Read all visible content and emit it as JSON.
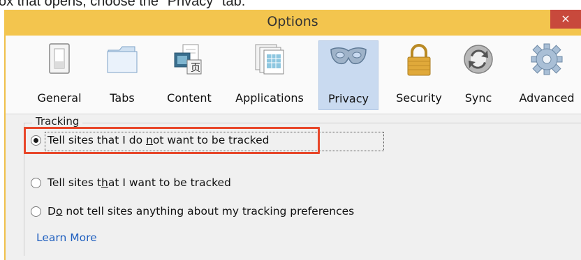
{
  "caption": "ox that opens, choose the \"Privacy\" tab.",
  "window": {
    "title": "Options",
    "close_glyph": "×"
  },
  "tabs": [
    {
      "label": "General",
      "icon": "general-icon",
      "selected": false
    },
    {
      "label": "Tabs",
      "icon": "tabs-icon",
      "selected": false
    },
    {
      "label": "Content",
      "icon": "content-icon",
      "selected": false
    },
    {
      "label": "Applications",
      "icon": "applications-icon",
      "selected": false
    },
    {
      "label": "Privacy",
      "icon": "mask-icon",
      "selected": true
    },
    {
      "label": "Security",
      "icon": "lock-icon",
      "selected": false
    },
    {
      "label": "Sync",
      "icon": "sync-icon",
      "selected": false
    },
    {
      "label": "Advanced",
      "icon": "gear-icon",
      "selected": false
    }
  ],
  "tracking": {
    "legend": "Tracking",
    "options": [
      {
        "pre": "Tell sites that I do ",
        "ul": "n",
        "post": "ot want to be tracked",
        "checked": true
      },
      {
        "pre": "Tell sites t",
        "ul": "h",
        "post": "at I want to be tracked",
        "checked": false
      },
      {
        "pre": "D",
        "ul": "o",
        "post": " not tell sites anything about my tracking preferences",
        "checked": false
      }
    ],
    "learn_more": "Learn More"
  },
  "colors": {
    "titlebar": "#f3c54e",
    "close_button": "#c8493c",
    "selected_tab": "#c9daf0",
    "highlight_box": "#e8472a",
    "link": "#1f5fbf"
  }
}
